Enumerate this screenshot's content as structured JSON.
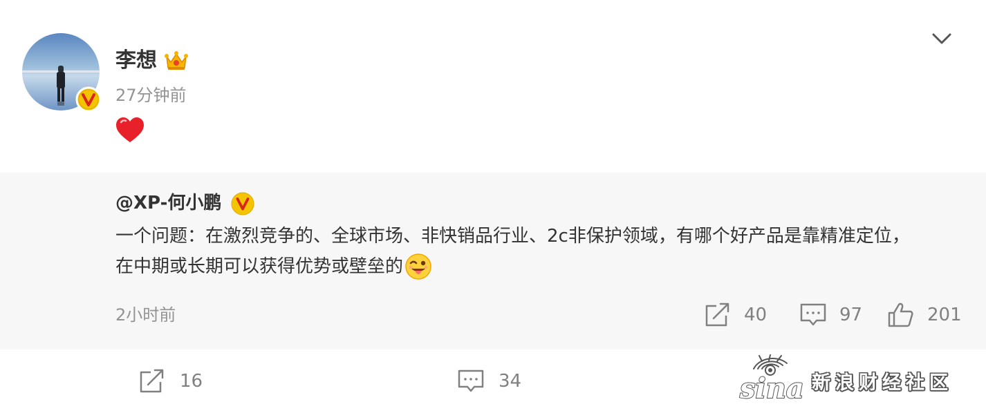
{
  "post": {
    "author": "李想",
    "time": "27分钟前",
    "content_emoji": "heart-emoji"
  },
  "quote": {
    "author": "@XP-何小鹏",
    "text_line1": "一个问题：在激烈竞争的、全球市场、非快销品行业、2c非保护领域，有哪个好产品是靠精准定位，",
    "text_line2": "在中期或长期可以获得优势或壁垒的",
    "text_emoji": "tongue-wink-emoji",
    "time": "2小时前",
    "reposts": "40",
    "comments": "97",
    "likes": "201"
  },
  "bottom": {
    "reposts": "16",
    "comments": "34"
  },
  "watermark": {
    "logo": "sina",
    "text": "新浪财经社区"
  },
  "colors": {
    "verified_badge": "#f5c400",
    "verified_badge_border": "#d8261f",
    "muted_text": "#939393",
    "icon_gray": "#808080",
    "quote_background": "#f7f7f7"
  }
}
